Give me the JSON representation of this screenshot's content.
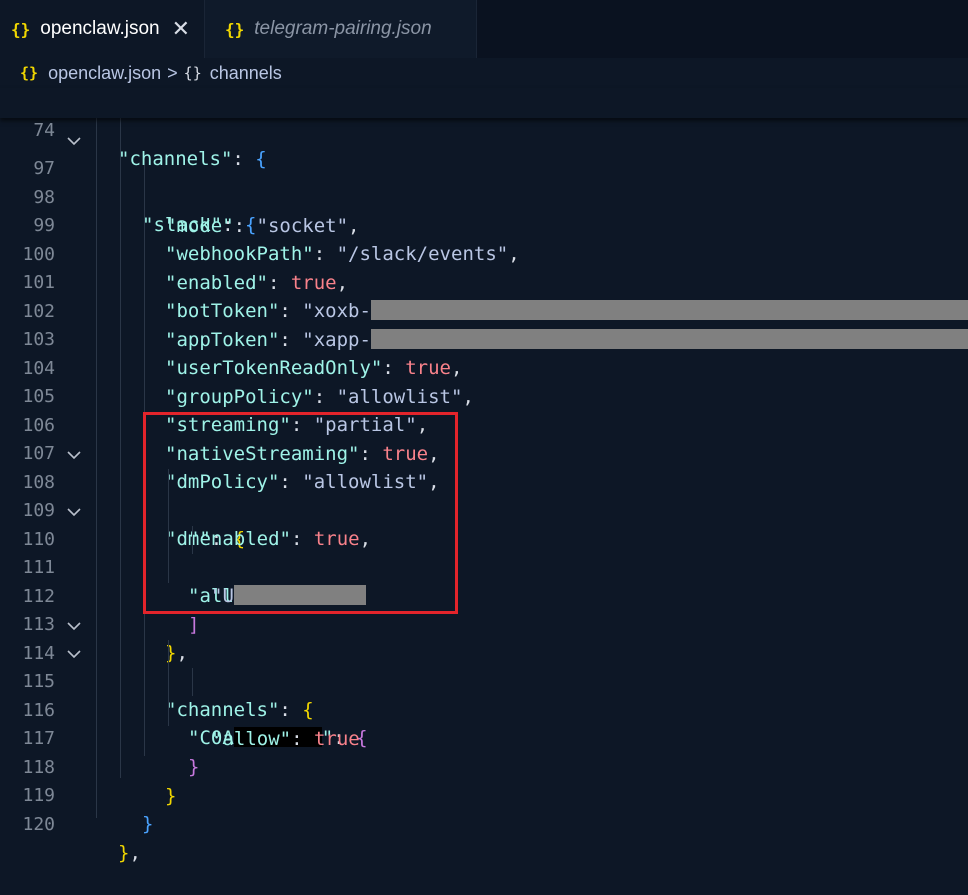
{
  "tabs": [
    {
      "icon": "{}",
      "label": "openclaw.json",
      "close": "✕"
    },
    {
      "icon": "{}",
      "label": "telegram-pairing.json"
    }
  ],
  "breadcrumb": {
    "file_icon": "{}",
    "file": "openclaw.json",
    "separator": ">",
    "symbol_icon": "{}",
    "symbol": "channels"
  },
  "sticky_line": {
    "number": "74",
    "key": "\"channels\"",
    "colon": ": ",
    "brace": "{"
  },
  "lines": [
    {
      "n": "97"
    },
    {
      "n": "98"
    },
    {
      "n": "99"
    },
    {
      "n": "100"
    },
    {
      "n": "101"
    },
    {
      "n": "102"
    },
    {
      "n": "103"
    },
    {
      "n": "104"
    },
    {
      "n": "105"
    },
    {
      "n": "106"
    },
    {
      "n": "107"
    },
    {
      "n": "108"
    },
    {
      "n": "109"
    },
    {
      "n": "110"
    },
    {
      "n": "111"
    },
    {
      "n": "112"
    },
    {
      "n": "113"
    },
    {
      "n": "114"
    },
    {
      "n": "115"
    },
    {
      "n": "116"
    },
    {
      "n": "117"
    },
    {
      "n": "118"
    },
    {
      "n": "119"
    },
    {
      "n": "120"
    }
  ],
  "code": {
    "slack_key": "\"slack\"",
    "mode_key": "\"mode\"",
    "mode_val": "\"socket\"",
    "webhook_key": "\"webhookPath\"",
    "webhook_val": "\"/slack/events\"",
    "enabled_key": "\"enabled\"",
    "true": "true",
    "bottoken_key": "\"botToken\"",
    "bottoken_val": "\"xoxb-",
    "apptoken_key": "\"appToken\"",
    "apptoken_val": "\"xapp-",
    "usertoken_key": "\"userTokenReadOnly\"",
    "grouppolicy_key": "\"groupPolicy\"",
    "grouppolicy_val": "\"allowlist\"",
    "streaming_key": "\"streaming\"",
    "streaming_val": "\"partial\"",
    "nativestreaming_key": "\"nativeStreaming\"",
    "dmpolicy_key": "\"dmPolicy\"",
    "dmpolicy_val": "\"allowlist\"",
    "dm_key": "\"dm\"",
    "dm_enabled_key": "\"enabled\"",
    "allowfrom_key": "\"allowFrom\"",
    "allowfrom_item": "\"U",
    "channels_key": "\"channels\"",
    "c0a_key": "\"C0A",
    "c0a_close": "\"",
    "allow_key": "\"allow\""
  },
  "colors": {
    "background": "#0d1726",
    "key": "#9ff3e8",
    "string": "#b9c6e4",
    "boolean": "#f9828b",
    "bracket_yellow": "#f1d700",
    "bracket_purple": "#c678dd",
    "bracket_blue": "#4aa3ff",
    "highlight": "#e3242b",
    "redaction_gray": "#808080",
    "redaction_black": "#000000"
  }
}
